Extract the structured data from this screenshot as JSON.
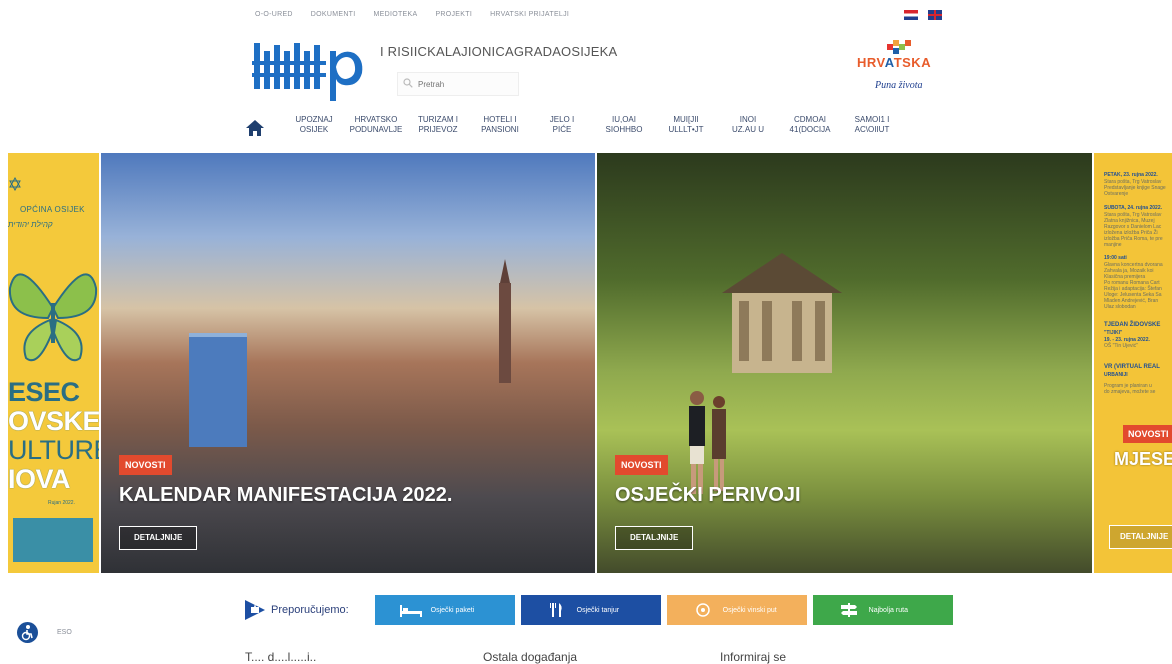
{
  "topbar": {
    "links": [
      "o-o-ured",
      "DOKUMENTI",
      "MEDIOTEKA",
      "PROJEKTI",
      "HRVATSKI PRIJATELJI"
    ]
  },
  "flags": {
    "croatian": "Hrvatski",
    "english": "English"
  },
  "header": {
    "site_title": "I RISIICKALAJIONICAGRADAOSIJEKA",
    "search_placeholder": "Pretrah",
    "brand_word_1": "HRV",
    "brand_word_2": "A",
    "brand_word_3": "TSKA",
    "brand_tagline": "Puna života"
  },
  "nav": {
    "items": [
      {
        "label": "UPOZNAJ\nOSIJEK"
      },
      {
        "label": "HRVATSKO\nPODUNAVLJE"
      },
      {
        "label": "TURIZAM I\nPRIJEVOZ"
      },
      {
        "label": "HOTELI I\nPANSIONI"
      },
      {
        "label": "JELO I\nPIĆE"
      },
      {
        "label": "IU,OAI\nSIOHHbO"
      },
      {
        "label": "MUI[JII\nUlllt•Jt"
      },
      {
        "label": "INOI\nuz.au u"
      },
      {
        "label": "CDMOAI\n41(dOCIJA"
      },
      {
        "label": "SAMOI1 ı\nAC\\OIIUt"
      }
    ]
  },
  "left_panel": {
    "org": "OPĆINA OSIJEK",
    "hebrew": "קהילת יהודית",
    "lines": [
      "ESEC",
      "OVSKE",
      "ULTURE",
      "IOVA"
    ],
    "date": "Rujan 2022.",
    "colors": {
      "bg": "#f4c93b",
      "ink": "#2a6e83"
    }
  },
  "slides": [
    {
      "badge": "NOVOSTI",
      "title": "KALENDAR MANIFESTACIJA 2022.",
      "button": "DETALJNIJE"
    },
    {
      "badge": "NOVOSTI",
      "title": "OSJEČKI PERIVOJI",
      "button": "DETALJNIJE"
    }
  ],
  "right_panel": {
    "entries": [
      {
        "text": "PETAK, 23. rujna 2022.",
        "style": "b"
      },
      {
        "text": "Stara pošta, Trg Vatroslav",
        "style": "small"
      },
      {
        "text": "Predstavljanje knjige Snage",
        "style": "small"
      },
      {
        "text": "Ostvarenje",
        "style": "small"
      },
      {
        "text": "SUBOTA, 24. rujna 2022.",
        "style": "b"
      },
      {
        "text": "Stara pošta, Trg Vatroslav",
        "style": "small"
      },
      {
        "text": "Zlatna knjižnica, Muzej",
        "style": "small"
      },
      {
        "text": "Razgovor s Danielom Lac",
        "style": "small"
      },
      {
        "text": "izložena izložba Priča Ži",
        "style": "small"
      },
      {
        "text": "izložba Priča Roma, te pre",
        "style": "small"
      },
      {
        "text": "manjine",
        "style": "small"
      },
      {
        "text": "19:00 sati",
        "style": "b"
      },
      {
        "text": "Glavna koncertna dvorana",
        "style": "small"
      },
      {
        "text": "Zahvala ja, Mozaik koi",
        "style": "small"
      },
      {
        "text": "Klasična premijera",
        "style": "small"
      },
      {
        "text": "Po romanu Romana Cart",
        "style": "small"
      },
      {
        "text": "Režija i adaptacija: Štefan",
        "style": "small"
      },
      {
        "text": "Uloge: Jelusenta Seka Sa",
        "style": "small"
      },
      {
        "text": "Mladen Andrejević, Bran",
        "style": "small"
      },
      {
        "text": "Ulaz slobodan",
        "style": "small"
      },
      {
        "text": "TJEDAN ŽIDOVSKE",
        "style": "b"
      },
      {
        "text": "\"TIJIKI\"",
        "style": "b"
      },
      {
        "text": "19. - 23. rujna 2022.",
        "style": "b"
      },
      {
        "text": "OŠ \"Tin Ujević\"",
        "style": "small"
      },
      {
        "text": "VR (VIRTUAL REAL",
        "style": "b"
      },
      {
        "text": "URBANIJI",
        "style": "b"
      },
      {
        "text": "Program je planiran u",
        "style": "small"
      },
      {
        "text": "do zmajeva, možete se",
        "style": "small"
      }
    ],
    "badge": "NOVOSTI",
    "title": "MJESEC",
    "button": "DETALJNIJE"
  },
  "recommend": {
    "label": "Preporučujemo:",
    "buttons": [
      {
        "label": "Osječki paketi",
        "icon": "bed-icon",
        "color": "#2c92d3"
      },
      {
        "label": "Osječki tanjur",
        "icon": "cutlery-icon",
        "color": "#1d4fa3"
      },
      {
        "label": "Osječki vinski put",
        "icon": "wine-icon",
        "color": "#f3b05c"
      },
      {
        "label": "Najbolja ruta",
        "icon": "signpost-icon",
        "color": "#3ea84a"
      }
    ]
  },
  "accessibility": {
    "label": "ESO"
  },
  "bottom": {
    "col1": "T.... d....l.....i..",
    "col2": "Ostala događanja",
    "col3": "Informiraj se"
  }
}
